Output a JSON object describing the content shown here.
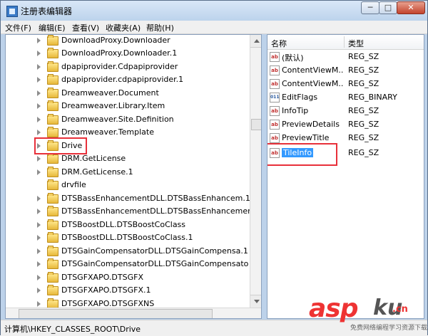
{
  "window": {
    "title": "注册表编辑器",
    "buttons": {
      "minimize": "─",
      "maximize": "□",
      "close": "✕"
    }
  },
  "menu": [
    "文件(F)",
    "编辑(E)",
    "查看(V)",
    "收藏夹(A)",
    "帮助(H)"
  ],
  "tree": {
    "items": [
      "DownloadProxy.Downloader",
      "DownloadProxy.Downloader.1",
      "dpapiprovider.Cdpapiprovider",
      "dpapiprovider.cdpapiprovider.1",
      "Dreamweaver.Document",
      "Dreamweaver.Library.Item",
      "Dreamweaver.Site.Definition",
      "Dreamweaver.Template",
      "Drive",
      "DRM.GetLicense",
      "DRM.GetLicense.1",
      "drvfile",
      "DTSBassEnhancementDLL.DTSBassEnhancem.1",
      "DTSBassEnhancementDLL.DTSBassEnhancemen",
      "DTSBoostDLL.DTSBoostCoClass",
      "DTSBoostDLL.DTSBoostCoClass.1",
      "DTSGainCompensatorDLL.DTSGainCompensa.1",
      "DTSGainCompensatorDLL.DTSGainCompensato",
      "DTSGFXAPO.DTSGFX",
      "DTSGFXAPO.DTSGFX.1",
      "DTSGFXAPO.DTSGFXNS"
    ],
    "highlighted": "Drive"
  },
  "list": {
    "headers": {
      "name": "名称",
      "type": "类型"
    },
    "rows": [
      {
        "name": "(默认)",
        "type": "REG_SZ",
        "icon": "ab"
      },
      {
        "name": "ContentViewM...",
        "type": "REG_SZ",
        "icon": "ab"
      },
      {
        "name": "ContentViewM...",
        "type": "REG_SZ",
        "icon": "ab"
      },
      {
        "name": "EditFlags",
        "type": "REG_BINARY",
        "icon": "011"
      },
      {
        "name": "InfoTip",
        "type": "REG_SZ",
        "icon": "ab"
      },
      {
        "name": "PreviewDetails",
        "type": "REG_SZ",
        "icon": "ab"
      },
      {
        "name": "PreviewTitle",
        "type": "REG_SZ",
        "icon": "ab"
      },
      {
        "name": "TileInfo",
        "type": "REG_SZ",
        "icon": "ab"
      }
    ],
    "selected": "TileInfo"
  },
  "status": {
    "path": "计算机\\HKEY_CLASSES_ROOT\\Drive"
  },
  "watermark": {
    "asp": "asp",
    "ku": "ku",
    "cn": ".cn",
    "sub": "免费网络编程学习资源下载站"
  },
  "colors": {
    "selection": "#3399ff",
    "annotation": "#e8303a",
    "folder": "#f2cd60"
  }
}
